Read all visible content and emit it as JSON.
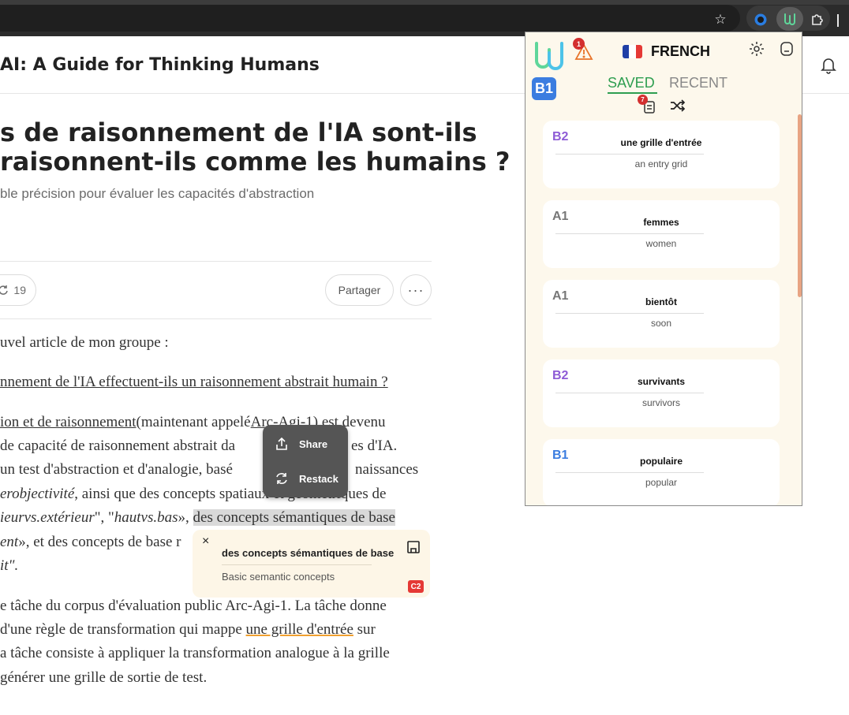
{
  "browser": {
    "icons": [
      "star-icon",
      "extension-blue-icon",
      "extension-active-icon",
      "puzzle-icon"
    ]
  },
  "page": {
    "site_title": "AI: A Guide for Thinking Humans",
    "headline_line1": "s de raisonnement de l'IA sont-ils",
    "headline_line2": "raisonnent-ils comme les humains ?",
    "subtitle": "ble précision pour évaluer les capacités d'abstraction",
    "restack_count": "19",
    "share_label": "Partager",
    "more_label": "···",
    "paragraphs": {
      "p1": "uvel article de mon groupe :",
      "p2": "nnement de l'IA effectuent-ils un raisonnement abstrait humain ?",
      "p3_a": "ion et de raisonnement",
      "p3_b": "(maintenant appelé",
      "p3_c": "Arc-Agi-1",
      "p3_d": ") est devenu",
      "p4": " de capacité de raisonnement abstrait da",
      "p4_end": "es d'IA.",
      "p5": "un test d'abstraction et d'analogie, basé",
      "p5_end": "naissances",
      "p6_a": "erobjectivité",
      "p6_b": ", ainsi que des concepts spatiaux et géométriques de",
      "p7_a": "ieurvs.extérieur",
      "p7_b": "\", \"",
      "p7_c": "hautvs.bas",
      "p7_d": "», ",
      "p7_hl": "des concepts sémantiques de base",
      "p8_a": "ent",
      "p8_b": "», et des concepts de base r",
      "p9": "it\".",
      "p10": "e tâche du corpus d'évaluation public Arc-Agi-1. La tâche donne",
      "p11_a": "d'une règle de transformation qui mappe ",
      "p11_u": "une grille d'entrée",
      "p11_b": " sur",
      "p12": "a tâche consiste à appliquer la transformation analogue à la grille",
      "p13": "générer une grille de sortie de test."
    }
  },
  "context_menu": {
    "share": "Share",
    "restack": "Restack"
  },
  "word_popup": {
    "word": "des concepts sémantiques de base",
    "translation": "Basic semantic concepts",
    "level": "C2",
    "close": "×"
  },
  "extension": {
    "alert_count": "1",
    "language": "FRENCH",
    "user_level": "B1",
    "tabs": {
      "saved": "SAVED",
      "recent": "RECENT"
    },
    "deck_count": "7",
    "cards": [
      {
        "level": "B2",
        "word": "une grille d'entrée",
        "translation": "an entry grid",
        "color": "#8e5bd6"
      },
      {
        "level": "A1",
        "word": "femmes",
        "translation": "women",
        "color": "#777777"
      },
      {
        "level": "A1",
        "word": "bientôt",
        "translation": "soon",
        "color": "#777777"
      },
      {
        "level": "B2",
        "word": "survivants",
        "translation": "survivors",
        "color": "#8e5bd6"
      },
      {
        "level": "B1",
        "word": "populaire",
        "translation": "popular",
        "color": "#3b7de0"
      }
    ]
  },
  "colors": {
    "accent_green": "#2e9e50",
    "level_b1": "#3b7de0",
    "level_b2": "#8e5bd6",
    "badge_red": "#d32f2f"
  }
}
